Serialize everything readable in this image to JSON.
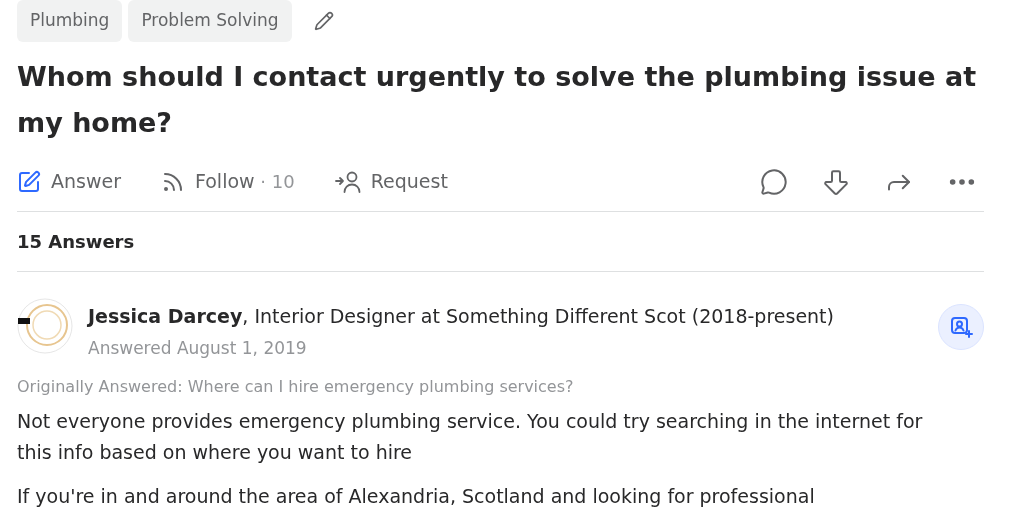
{
  "tags": [
    "Plumbing",
    "Problem Solving"
  ],
  "question": {
    "title": "Whom should I contact urgently to solve the plumbing issue at my home?"
  },
  "actions": [
    {
      "kind": "answer",
      "label": "Answer"
    },
    {
      "kind": "follow",
      "label": "Follow",
      "count": "· 10"
    },
    {
      "kind": "request",
      "label": "Request"
    }
  ],
  "answers_count": "15 Answers",
  "answer": {
    "author_line": "**Jessica Darcey**, Interior Designer at Something Different Scot (2018-present)",
    "date": "Answered August 1, 2019",
    "originally_answered": "Originally Answered: Where can I hire emergency plumbing services?",
    "paragraphs": [
      "Not everyone provides emergency plumbing service. You could try searching in the internet for this info based on where you want to hire",
      "If you're in and around the area of Alexandria, Scotland and looking for professional"
    ]
  }
}
